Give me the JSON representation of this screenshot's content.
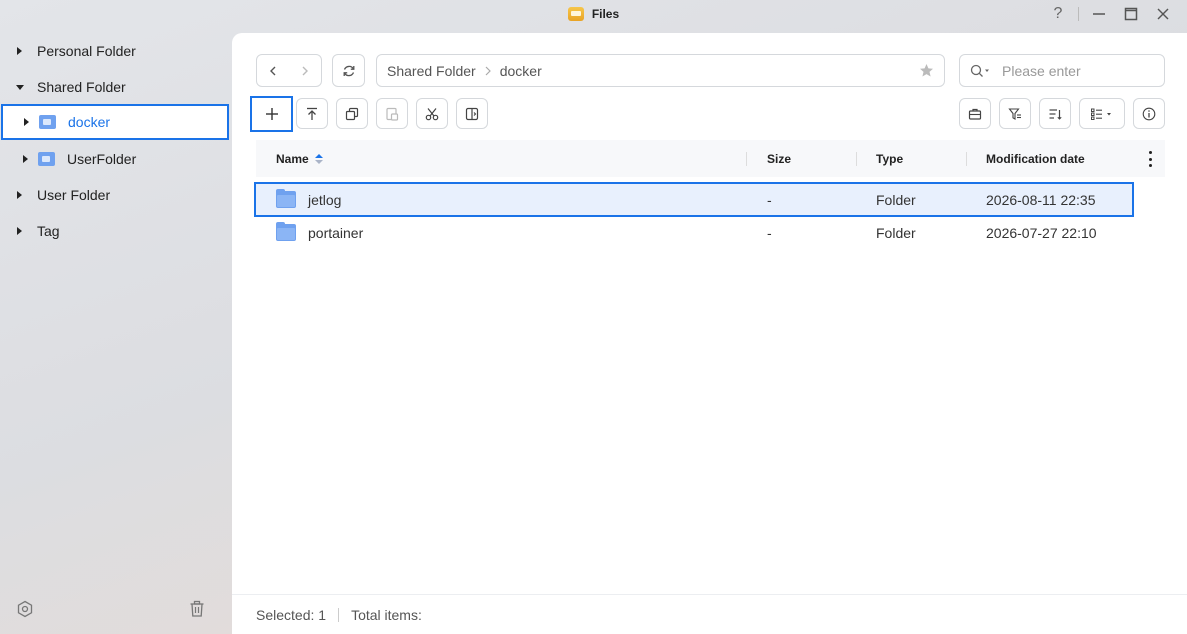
{
  "window": {
    "title": "Files",
    "help_glyph": "?"
  },
  "sidebar": {
    "items": [
      {
        "label": "Personal Folder",
        "expanded": false
      },
      {
        "label": "Shared Folder",
        "expanded": true
      },
      {
        "label": "docker",
        "selected": true,
        "icon": "shared-folder-icon"
      },
      {
        "label": "UserFolder",
        "icon": "user-folder-icon"
      },
      {
        "label": "User Folder",
        "expanded": false
      },
      {
        "label": "Tag",
        "expanded": false
      }
    ]
  },
  "breadcrumb": {
    "items": [
      "Shared Folder",
      "docker"
    ]
  },
  "search": {
    "placeholder": "Please enter"
  },
  "table": {
    "columns": [
      "Name",
      "Size",
      "Type",
      "Modification date"
    ],
    "sort": {
      "column": "Name",
      "direction": "asc"
    },
    "rows": [
      {
        "name": "jetlog",
        "size": "-",
        "type": "Folder",
        "modified": "2026-08-11 22:35",
        "selected": true
      },
      {
        "name": "portainer",
        "size": "-",
        "type": "Folder",
        "modified": "2026-07-27 22:10",
        "selected": false
      }
    ]
  },
  "status": {
    "selected": "Selected: 1",
    "total": "Total items:"
  },
  "colors": {
    "accent": "#1a73e8",
    "folder": "#6fa1ef",
    "selected_row_bg": "#e8f0fd"
  }
}
